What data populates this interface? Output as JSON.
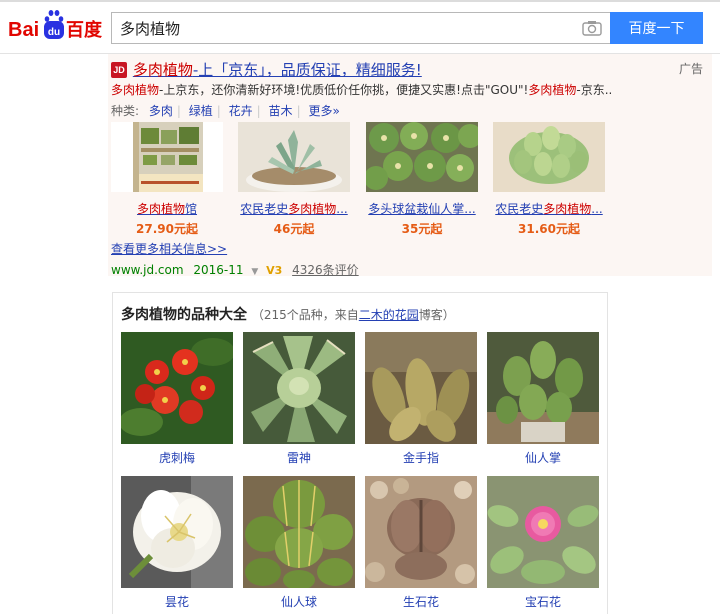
{
  "search": {
    "query": "多肉植物",
    "button_label": "百度一下"
  },
  "brand": {
    "logo_text_left": "Bai",
    "logo_text_du": "du",
    "logo_text_cn": "百度"
  },
  "ad": {
    "label": "广告",
    "badge": "JD",
    "title_highlight": "多肉植物",
    "title_rest": "-上「京东」，品质保证，精细服务!",
    "desc_highlight1": "多肉植物",
    "desc_middle": "-上京东，还你清新好环境!优质低价任你挑，便捷又实惠!点击\"GOU\"!",
    "desc_highlight2": "多肉植物",
    "desc_tail": "-京东...",
    "category_label": "种类:",
    "categories": [
      "多肉",
      "绿植",
      "花卉",
      "苗木",
      "更多»"
    ],
    "products": [
      {
        "name_pre": "",
        "name_hl": "多肉植物",
        "name_post": "馆",
        "price": "27.90元起",
        "image": "shop-sign"
      },
      {
        "name_pre": "农民老史",
        "name_hl": "多肉植物",
        "name_post": "...",
        "price": "46元起",
        "image": "potted-succulent"
      },
      {
        "name_pre": "多头球盆栽仙人掌...",
        "name_hl": "",
        "name_post": "",
        "price": "35元起",
        "image": "cactus-balls"
      },
      {
        "name_pre": "农民老史",
        "name_hl": "多肉植物",
        "name_post": "...",
        "price": "31.60元起",
        "image": "jelly-bean-succulent"
      }
    ],
    "more_link": "查看更多相关信息>>",
    "url": "www.jd.com",
    "date": "2016-11",
    "v_badge": "V3",
    "reviews": "4326条评价"
  },
  "card": {
    "title": "多肉植物的品种大全",
    "sub_pre": "（215个品种，来自",
    "sub_link": "二木的花园",
    "sub_post": "博客）",
    "species": [
      {
        "name": "虎刺梅",
        "image": "red-flower"
      },
      {
        "name": "雷神",
        "image": "agave"
      },
      {
        "name": "金手指",
        "image": "golden-cactus"
      },
      {
        "name": "仙人掌",
        "image": "prickly-pear"
      },
      {
        "name": "昙花",
        "image": "white-bloom"
      },
      {
        "name": "仙人球",
        "image": "barrel-cactus"
      },
      {
        "name": "生石花",
        "image": "living-stones"
      },
      {
        "name": "宝石花",
        "image": "pink-flower"
      }
    ]
  },
  "colors": {
    "accent": "#3385ff",
    "link": "#2440b3",
    "highlight": "#cc0000",
    "price": "#e55c16",
    "url_green": "#008000",
    "ad_bg": "#fcf6f3"
  }
}
